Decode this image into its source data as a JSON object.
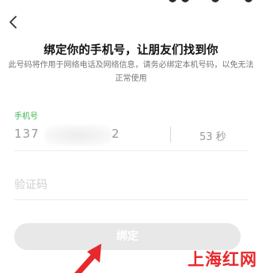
{
  "header": {
    "back_icon": "chevron-left-icon"
  },
  "main": {
    "title": "绑定你的手机号，让朋友们找到你",
    "subtitle": "此号码将作用于网络电话及网络信息，请务必绑定本机号码，以免无法正常使用"
  },
  "phone_field": {
    "label": "手机号",
    "value_prefix": "137",
    "value_suffix": "2",
    "countdown": "53 秒"
  },
  "code_field": {
    "placeholder": "验证码",
    "value": ""
  },
  "bind_button": {
    "label": "绑定"
  },
  "watermark": {
    "text": "上海红网"
  },
  "colors": {
    "accent_green": "#3bb54a",
    "button_disabled": "#e8e8e8",
    "annotation_red": "#e8282b"
  }
}
